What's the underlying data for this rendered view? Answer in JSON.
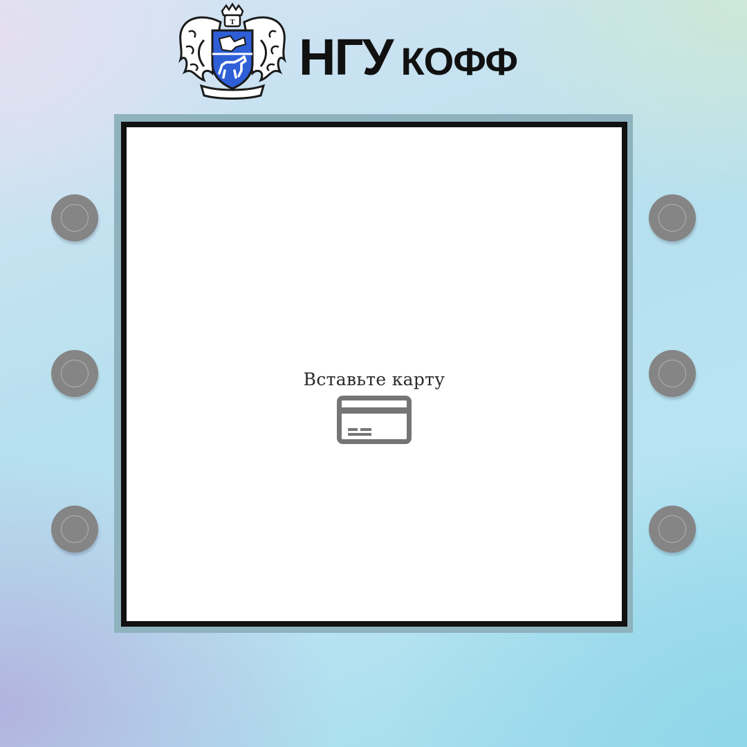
{
  "header": {
    "brand_part_1": "НГУ",
    "brand_part_2": "КОФФ",
    "logo_icon": "bank-crest-icon"
  },
  "screen": {
    "prompt": "Вставьте карту",
    "card_icon": "credit-card-icon"
  },
  "side_keys": {
    "left": [
      "",
      "",
      ""
    ],
    "right": [
      "",
      "",
      ""
    ]
  },
  "colors": {
    "screen_border": "#111111",
    "bezel": "#8fb2bf",
    "key": "#858585",
    "crest_blue": "#2f5fd6",
    "icon_gray": "#757575"
  }
}
